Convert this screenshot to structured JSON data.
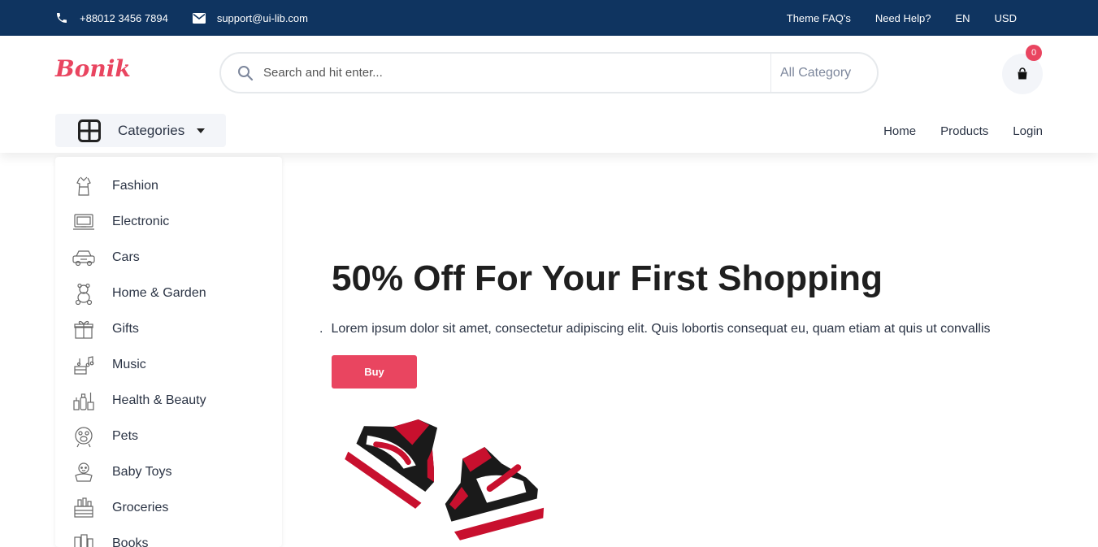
{
  "topbar": {
    "phone": "+88012 3456 7894",
    "email": "support@ui-lib.com",
    "links": [
      "Theme FAQ's",
      "Need Help?"
    ],
    "language": "EN",
    "currency": "USD"
  },
  "header": {
    "logo": "Bonik",
    "search_placeholder": "Search and hit enter...",
    "category_select": "All Category",
    "cart_count": "0"
  },
  "categories_button": {
    "label": "Categories"
  },
  "nav": {
    "items": [
      "Home",
      "Products",
      "Login"
    ]
  },
  "sidebar": {
    "items": [
      {
        "label": "Fashion",
        "icon": "dress-icon"
      },
      {
        "label": "Electronic",
        "icon": "laptop-icon"
      },
      {
        "label": "Cars",
        "icon": "car-icon"
      },
      {
        "label": "Home & Garden",
        "icon": "teddy-bear-icon"
      },
      {
        "label": "Gifts",
        "icon": "gift-icon"
      },
      {
        "label": "Music",
        "icon": "music-icon"
      },
      {
        "label": "Health & Beauty",
        "icon": "cosmetics-icon"
      },
      {
        "label": "Pets",
        "icon": "paw-icon"
      },
      {
        "label": "Baby Toys",
        "icon": "baby-icon"
      },
      {
        "label": "Groceries",
        "icon": "basket-icon"
      },
      {
        "label": "Books",
        "icon": "books-icon"
      }
    ]
  },
  "hero": {
    "title": "50% Off For Your First Shopping",
    "bullet": ".",
    "text": "Lorem ipsum dolor sit amet, consectetur adipiscing elit. Quis lobortis consequat eu, quam etiam at quis ut convallis",
    "button": "Buy"
  },
  "colors": {
    "topbar": "#0f3460",
    "accent": "#e94560",
    "text": "#2b3445"
  }
}
